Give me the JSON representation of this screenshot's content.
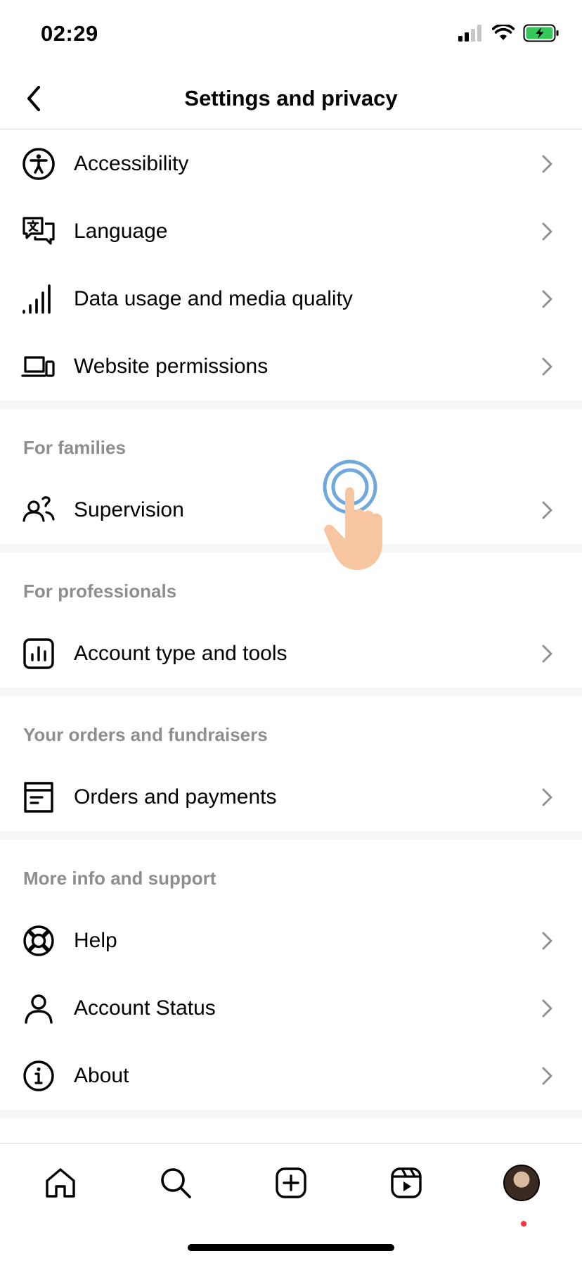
{
  "status_bar": {
    "time": "02:29"
  },
  "nav": {
    "title": "Settings and privacy"
  },
  "sections": [
    {
      "header": "",
      "items": [
        {
          "label": "Accessibility",
          "icon": "accessibility-icon"
        },
        {
          "label": "Language",
          "icon": "language-icon"
        },
        {
          "label": "Data usage and media quality",
          "icon": "signal-bars-icon"
        },
        {
          "label": "Website permissions",
          "icon": "devices-icon"
        }
      ]
    },
    {
      "header": "For families",
      "items": [
        {
          "label": "Supervision",
          "icon": "supervision-icon"
        }
      ]
    },
    {
      "header": "For professionals",
      "items": [
        {
          "label": "Account type and tools",
          "icon": "insights-icon"
        }
      ]
    },
    {
      "header": "Your orders and fundraisers",
      "items": [
        {
          "label": "Orders and payments",
          "icon": "orders-icon"
        }
      ]
    },
    {
      "header": "More info and support",
      "items": [
        {
          "label": "Help",
          "icon": "lifebuoy-icon"
        },
        {
          "label": "Account Status",
          "icon": "person-icon"
        },
        {
          "label": "About",
          "icon": "info-icon"
        }
      ]
    }
  ],
  "tab_bar": {
    "tabs": [
      {
        "name": "home-icon"
      },
      {
        "name": "search-icon"
      },
      {
        "name": "create-icon"
      },
      {
        "name": "reels-icon"
      },
      {
        "name": "profile-avatar"
      }
    ],
    "notification_dot_color": "#ff3040"
  },
  "colors": {
    "section_header": "#8e8e8e",
    "separator": "#f7f7f7",
    "divider": "#dbdbdb"
  }
}
